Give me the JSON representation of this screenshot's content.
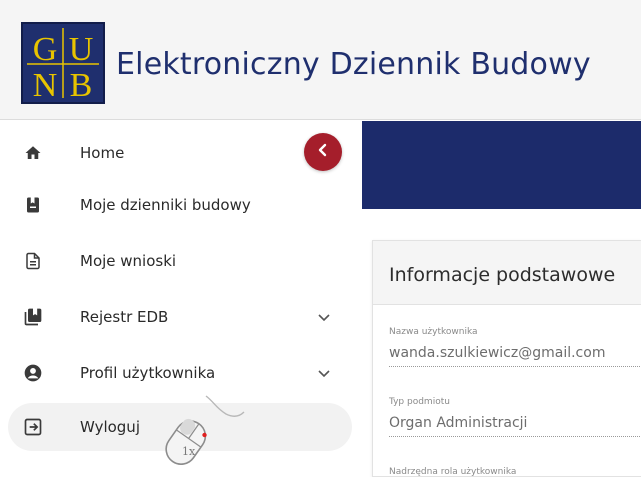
{
  "header": {
    "logo_text": "GUNB",
    "title": "Elektroniczny Dziennik Budowy"
  },
  "sidebar": {
    "collapse_icon": "chevron-left-icon",
    "items": [
      {
        "label": "Home",
        "icon": "home-icon",
        "expandable": false
      },
      {
        "label": "Moje dzienniki budowy",
        "icon": "book-icon",
        "expandable": false
      },
      {
        "label": "Moje wnioski",
        "icon": "document-icon",
        "expandable": false
      },
      {
        "label": "Rejestr EDB",
        "icon": "library-icon",
        "expandable": true
      },
      {
        "label": "Profil użytkownika",
        "icon": "account-icon",
        "expandable": true
      },
      {
        "label": "Wyloguj",
        "icon": "logout-icon",
        "expandable": false
      }
    ]
  },
  "card": {
    "title": "Informacje podstawowe",
    "fields": [
      {
        "label": "Nazwa użytkownika",
        "value": "wanda.szulkiewicz@gmail.com"
      },
      {
        "label": "Typ podmiotu",
        "value": "Organ Administracji"
      },
      {
        "label": "Nadrzędna rola użytkownika",
        "value": ""
      }
    ]
  },
  "cursor_overlay": {
    "text": "1x",
    "icon": "mouse-click-icon"
  },
  "colors": {
    "brand_navy": "#1c2b6b",
    "accent_red": "#a51e2b",
    "logo_gold": "#e8c400"
  }
}
